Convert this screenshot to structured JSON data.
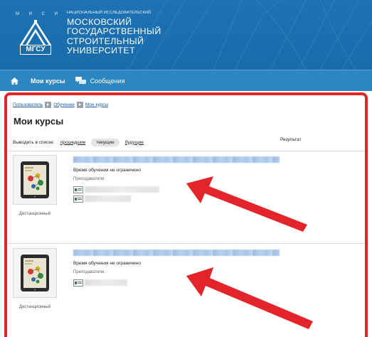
{
  "header": {
    "logo_letters": [
      "М",
      "И",
      "С",
      "И"
    ],
    "logo_badge": "МГСУ",
    "uni_small": "НАЦИОНАЛЬНЫЙ ИССЛЕДОВАТЕЛЬСКИЙ",
    "uni_name": [
      "МОСКОВСКИЙ",
      "ГОСУДАРСТВЕННЫЙ",
      "СТРОИТЕЛЬНЫЙ",
      "УНИВЕРСИТЕТ"
    ]
  },
  "nav": {
    "home_icon": "home-icon",
    "my_courses": "Мои курсы",
    "messages": "Сообщения",
    "messages_icon": "messages-icon"
  },
  "breadcrumb": [
    "Пользователь",
    "Обучение",
    "Мои курсы"
  ],
  "page_title": "Мои курсы",
  "filter": {
    "label": "Выводить в списке:",
    "options": [
      "прошедшие",
      "текущие",
      "будущие"
    ],
    "selected": "текущие",
    "result_label": "Результат"
  },
  "courses": [
    {
      "time_text": "Время обучения не ограничено",
      "teachers_label": "Преподаватели:",
      "type_label": "Дистанционный"
    },
    {
      "time_text": "Время обучения не ограничено",
      "teachers_label": "Преподаватели:",
      "type_label": "Дистанционный"
    }
  ],
  "colors": {
    "header_bg": "#1e73b4",
    "nav_bg": "#2e86c1",
    "annotation_red": "#e3242b",
    "link": "#1a5fa8"
  }
}
